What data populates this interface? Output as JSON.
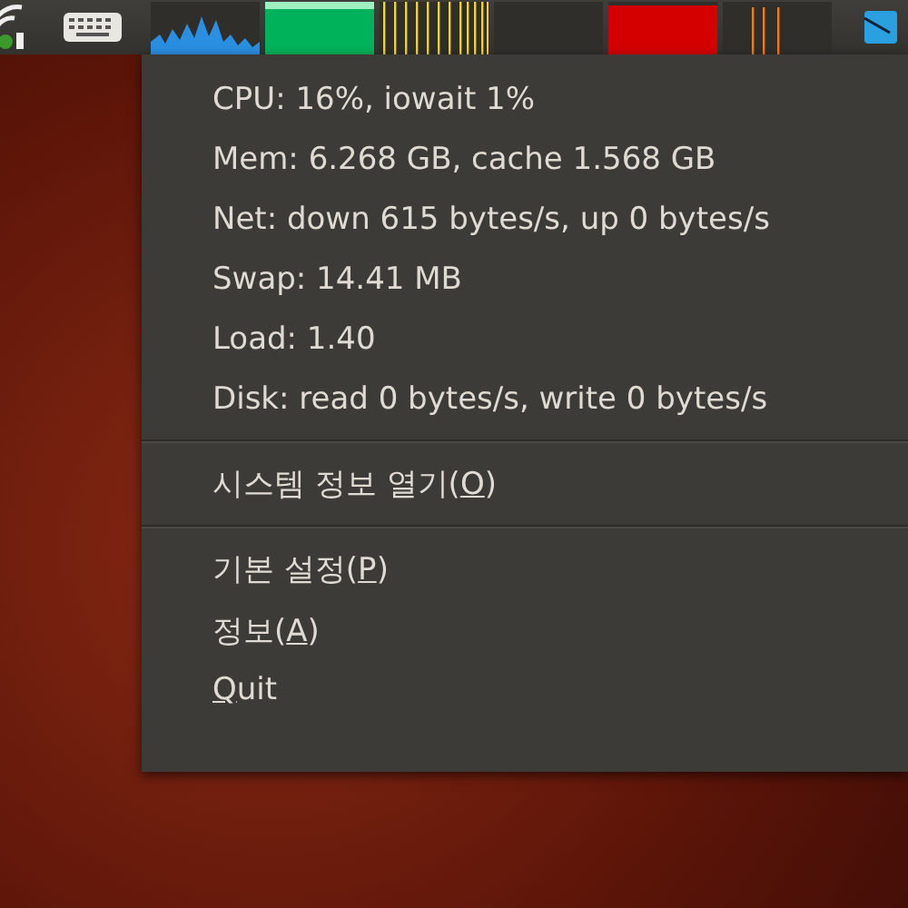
{
  "menu": {
    "info_lines": [
      "CPU: 16%, iowait 1%",
      "Mem: 6.268 GB, cache 1.568 GB",
      "Net: down 615 bytes/s, up 0 bytes/s",
      "Swap: 14.41 MB",
      "Load: 1.40",
      "Disk: read 0 bytes/s, write 0 bytes/s"
    ],
    "actions": [
      [
        {
          "before": "시스템 정보 열기(",
          "key": "O",
          "after": ")"
        }
      ],
      [
        {
          "before": "기본 설정(",
          "key": "P",
          "after": ")"
        },
        {
          "before": "정보(",
          "key": "A",
          "after": ")"
        },
        {
          "key": "Q",
          "after": "uit"
        }
      ]
    ]
  }
}
